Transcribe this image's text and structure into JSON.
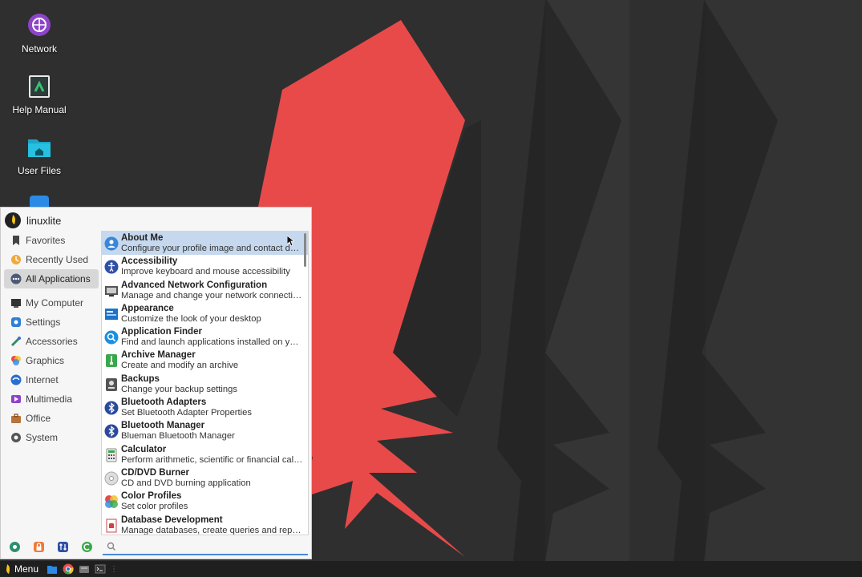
{
  "desktop": {
    "icons": [
      {
        "label": "Network",
        "icon": "globe-icon"
      },
      {
        "label": "Help Manual",
        "icon": "book-icon"
      },
      {
        "label": "User Files",
        "icon": "home-folder-icon"
      }
    ],
    "wallpaper_colors": {
      "background": "#2f2f2f",
      "stripe": "#3a3a3a",
      "accent": "#e84a4a"
    }
  },
  "menu": {
    "username": "linuxlite",
    "categories": [
      {
        "label": "Favorites",
        "icon": "bookmark-icon"
      },
      {
        "label": "Recently Used",
        "icon": "clock-icon"
      },
      {
        "label": "All Applications",
        "icon": "apps-icon",
        "selected": true
      },
      {
        "label": "My Computer",
        "icon": "monitor-icon"
      },
      {
        "label": "Settings",
        "icon": "gear-icon"
      },
      {
        "label": "Accessories",
        "icon": "accessories-icon"
      },
      {
        "label": "Graphics",
        "icon": "graphics-icon"
      },
      {
        "label": "Internet",
        "icon": "internet-icon"
      },
      {
        "label": "Multimedia",
        "icon": "multimedia-icon"
      },
      {
        "label": "Office",
        "icon": "briefcase-icon"
      },
      {
        "label": "System",
        "icon": "system-gear-icon"
      }
    ],
    "apps": [
      {
        "name": "About Me",
        "desc": "Configure your profile image and contact details",
        "icon": "user-icon",
        "selected": true
      },
      {
        "name": "Accessibility",
        "desc": "Improve keyboard and mouse accessibility",
        "icon": "accessibility-icon"
      },
      {
        "name": "Advanced Network Configuration",
        "desc": "Manage and change your network connection s...",
        "icon": "network-config-icon"
      },
      {
        "name": "Appearance",
        "desc": "Customize the look of your desktop",
        "icon": "appearance-icon"
      },
      {
        "name": "Application Finder",
        "desc": "Find and launch applications installed on your ...",
        "icon": "finder-icon"
      },
      {
        "name": "Archive Manager",
        "desc": "Create and modify an archive",
        "icon": "archive-icon"
      },
      {
        "name": "Backups",
        "desc": "Change your backup settings",
        "icon": "backup-icon"
      },
      {
        "name": "Bluetooth Adapters",
        "desc": "Set Bluetooth Adapter Properties",
        "icon": "bluetooth-icon"
      },
      {
        "name": "Bluetooth Manager",
        "desc": "Blueman Bluetooth Manager",
        "icon": "bluetooth-icon"
      },
      {
        "name": "Calculator",
        "desc": "Perform arithmetic, scientific or financial calcul...",
        "icon": "calculator-icon"
      },
      {
        "name": "CD/DVD Burner",
        "desc": "CD and DVD burning application",
        "icon": "disc-icon"
      },
      {
        "name": "Color Profiles",
        "desc": "Set color profiles",
        "icon": "color-profile-icon"
      },
      {
        "name": "Database Development",
        "desc": "Manage databases, create queries and reports t...",
        "icon": "database-icon"
      }
    ],
    "bottom_actions": [
      "settings-icon",
      "lock-icon",
      "switch-user-icon",
      "logout-icon"
    ],
    "search": {
      "value": "",
      "placeholder": ""
    }
  },
  "taskbar": {
    "menu_label": "Menu",
    "launchers": [
      "file-manager-icon",
      "chrome-icon",
      "drive-icon",
      "terminal-icon"
    ]
  }
}
